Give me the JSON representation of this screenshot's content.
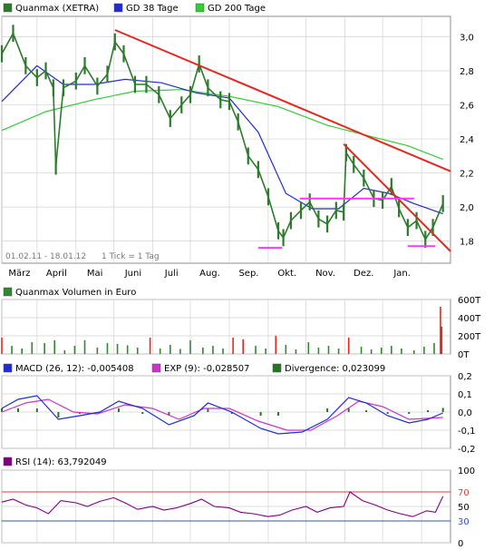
{
  "colors": {
    "background": "#ffffff",
    "frame": "#8c8c8c",
    "grid": "#d2d2d2",
    "price": "#2d7a2d",
    "sma38": "#1f2bd6",
    "sma200": "#33cc33",
    "trend": "#e8261e",
    "support": "#ff33ff",
    "volume": "#2d8a2d",
    "volume_spike": "#e8261e",
    "macd": "#1f2bd6",
    "exp": "#cc33cc",
    "divergence": "#1f7a1f",
    "rsi": "#800080",
    "rsi_upper": "#d6403a",
    "rsi_lower": "#3050d0"
  },
  "chart_data": [
    {
      "type": "line",
      "name": "price",
      "legend": {
        "price": "Quanmax (XETRA)",
        "sma38": "GD 38 Tage",
        "sma200": "GD 200 Tage"
      },
      "date_range_label": "01.02.11 - 18.01.12",
      "tick_note": "1 Tick = 1 Tag",
      "x_labels": [
        "März",
        "April",
        "Mai",
        "Juni",
        "Juli",
        "Aug.",
        "Sep.",
        "Okt.",
        "Nov.",
        "Dez.",
        "Jan."
      ],
      "y_ticks": [
        "3,0",
        "2,8",
        "2,6",
        "2,4",
        "2,2",
        "2,0",
        "1,8"
      ],
      "ylim": [
        1.67,
        3.12
      ],
      "series": [
        {
          "name": "Quanmax (XETRA)",
          "x": [
            "2011-02-01",
            "2011-02-10",
            "2011-02-20",
            "2011-03-01",
            "2011-03-08",
            "2011-03-14",
            "2011-03-16",
            "2011-03-22",
            "2011-04-01",
            "2011-04-08",
            "2011-04-18",
            "2011-04-26",
            "2011-05-02",
            "2011-05-09",
            "2011-05-18",
            "2011-05-27",
            "2011-06-06",
            "2011-06-15",
            "2011-06-24",
            "2011-07-01",
            "2011-07-08",
            "2011-07-15",
            "2011-07-25",
            "2011-08-01",
            "2011-08-08",
            "2011-08-16",
            "2011-08-24",
            "2011-09-01",
            "2011-09-09",
            "2011-09-13",
            "2011-09-19",
            "2011-09-27",
            "2011-10-04",
            "2011-10-11",
            "2011-10-18",
            "2011-10-25",
            "2011-10-31",
            "2011-11-02",
            "2011-11-08",
            "2011-11-16",
            "2011-11-24",
            "2011-12-01",
            "2011-12-08",
            "2011-12-14",
            "2011-12-21",
            "2011-12-28",
            "2012-01-04",
            "2012-01-10",
            "2012-01-18"
          ],
          "y": [
            2.9,
            3.02,
            2.83,
            2.76,
            2.8,
            2.7,
            2.24,
            2.7,
            2.74,
            2.83,
            2.71,
            2.78,
            2.97,
            2.9,
            2.72,
            2.72,
            2.66,
            2.52,
            2.6,
            2.66,
            2.84,
            2.7,
            2.63,
            2.62,
            2.5,
            2.3,
            2.22,
            2.06,
            1.86,
            1.82,
            1.92,
            1.98,
            2.03,
            1.93,
            1.9,
            1.98,
            1.97,
            2.32,
            2.25,
            2.17,
            2.05,
            2.04,
            2.12,
            1.99,
            1.88,
            1.92,
            1.81,
            1.88,
            2.02
          ]
        },
        {
          "name": "GD 38 Tage",
          "x": [
            "2011-02-01",
            "2011-03-01",
            "2011-03-22",
            "2011-04-15",
            "2011-05-10",
            "2011-06-08",
            "2011-07-06",
            "2011-08-01",
            "2011-08-24",
            "2011-09-15",
            "2011-10-06",
            "2011-10-27",
            "2011-11-16",
            "2011-12-06",
            "2011-12-26",
            "2012-01-18"
          ],
          "y": [
            2.62,
            2.83,
            2.72,
            2.72,
            2.75,
            2.73,
            2.67,
            2.64,
            2.44,
            2.08,
            1.99,
            1.99,
            2.11,
            2.08,
            2.02,
            1.96
          ]
        },
        {
          "name": "GD 200 Tage",
          "x": [
            "2011-02-01",
            "2011-03-08",
            "2011-04-15",
            "2011-05-18",
            "2011-06-24",
            "2011-08-01",
            "2011-09-09",
            "2011-10-18",
            "2011-11-24",
            "2011-12-21",
            "2012-01-18"
          ],
          "y": [
            2.45,
            2.56,
            2.63,
            2.68,
            2.69,
            2.65,
            2.59,
            2.48,
            2.41,
            2.36,
            2.28
          ]
        }
      ],
      "annotations": [
        {
          "kind": "trendline",
          "x": [
            "2011-05-02",
            "2012-01-24"
          ],
          "y": [
            3.04,
            2.21
          ]
        },
        {
          "kind": "trendline",
          "x": [
            "2011-10-31",
            "2012-01-24"
          ],
          "y": [
            2.37,
            1.74
          ]
        },
        {
          "kind": "support",
          "x": [
            "2011-09-26",
            "2011-12-26"
          ],
          "y": [
            2.05,
            2.05
          ]
        },
        {
          "kind": "support",
          "x": [
            "2011-08-24",
            "2011-09-12"
          ],
          "y": [
            1.76,
            1.76
          ]
        },
        {
          "kind": "support",
          "x": [
            "2011-12-21",
            "2012-01-12"
          ],
          "y": [
            1.77,
            1.77
          ]
        }
      ]
    },
    {
      "type": "bar",
      "name": "volume",
      "title": "Quanmax Volumen in Euro",
      "y_ticks": [
        "600T",
        "400T",
        "200T",
        "0T"
      ],
      "ylim": [
        0,
        600
      ],
      "unit": "T",
      "x": [
        "2011-02-01",
        "2011-02-09",
        "2011-02-17",
        "2011-02-25",
        "2011-03-07",
        "2011-03-15",
        "2011-03-23",
        "2011-03-31",
        "2011-04-08",
        "2011-04-18",
        "2011-04-26",
        "2011-05-04",
        "2011-05-12",
        "2011-05-20",
        "2011-05-30",
        "2011-06-07",
        "2011-06-15",
        "2011-06-23",
        "2011-07-01",
        "2011-07-11",
        "2011-07-19",
        "2011-07-27",
        "2011-08-04",
        "2011-08-12",
        "2011-08-22",
        "2011-08-30",
        "2011-09-07",
        "2011-09-15",
        "2011-09-23",
        "2011-10-03",
        "2011-10-11",
        "2011-10-19",
        "2011-10-27",
        "2011-11-04",
        "2011-11-14",
        "2011-11-22",
        "2011-11-30",
        "2011-12-08",
        "2011-12-16",
        "2011-12-26",
        "2012-01-03",
        "2012-01-11",
        "2012-01-16",
        "2012-01-17"
      ],
      "values": [
        180,
        90,
        60,
        130,
        120,
        150,
        40,
        90,
        150,
        70,
        120,
        110,
        95,
        70,
        180,
        60,
        100,
        55,
        150,
        70,
        90,
        60,
        180,
        160,
        90,
        60,
        200,
        100,
        50,
        130,
        70,
        90,
        60,
        180,
        80,
        50,
        70,
        90,
        60,
        40,
        80,
        120,
        520,
        300
      ]
    },
    {
      "type": "line",
      "name": "macd",
      "legend": {
        "macd": "MACD (26, 12): -0,005408",
        "exp": "EXP (9): -0,028507",
        "divergence": "Divergence: 0,023099"
      },
      "y_ticks": [
        "0,2",
        "0,1",
        "0,0",
        "-0,1",
        "-0,2"
      ],
      "ylim": [
        -0.2,
        0.2
      ],
      "series": [
        {
          "name": "MACD (26, 12)",
          "x": [
            "2011-02-01",
            "2011-02-14",
            "2011-03-01",
            "2011-03-18",
            "2011-04-04",
            "2011-04-20",
            "2011-05-05",
            "2011-05-24",
            "2011-06-14",
            "2011-07-04",
            "2011-07-15",
            "2011-08-03",
            "2011-08-26",
            "2011-09-09",
            "2011-09-28",
            "2011-10-18",
            "2011-11-04",
            "2011-11-18",
            "2011-12-05",
            "2011-12-22",
            "2012-01-06",
            "2012-01-18"
          ],
          "y": [
            0.02,
            0.07,
            0.09,
            -0.04,
            -0.02,
            0.0,
            0.06,
            0.02,
            -0.07,
            -0.02,
            0.05,
            0.0,
            -0.09,
            -0.12,
            -0.11,
            -0.04,
            0.08,
            0.05,
            -0.02,
            -0.06,
            -0.04,
            -0.005
          ]
        },
        {
          "name": "EXP (9)",
          "x": [
            "2011-02-01",
            "2011-02-20",
            "2011-03-10",
            "2011-03-30",
            "2011-04-18",
            "2011-05-10",
            "2011-06-01",
            "2011-06-22",
            "2011-07-12",
            "2011-08-01",
            "2011-08-24",
            "2011-09-16",
            "2011-10-05",
            "2011-10-26",
            "2011-11-12",
            "2011-12-01",
            "2011-12-22",
            "2012-01-18"
          ],
          "y": [
            0.0,
            0.05,
            0.07,
            0.0,
            -0.01,
            0.04,
            0.02,
            -0.04,
            0.02,
            0.02,
            -0.05,
            -0.1,
            -0.1,
            -0.02,
            0.06,
            0.03,
            -0.04,
            -0.03
          ]
        }
      ],
      "divergence_x": [
        "2011-02-01",
        "2011-02-14",
        "2011-03-01",
        "2011-03-18",
        "2011-04-04",
        "2011-04-20",
        "2011-05-05",
        "2011-05-24",
        "2011-06-14",
        "2011-07-04",
        "2011-07-15",
        "2011-08-03",
        "2011-08-26",
        "2011-09-09",
        "2011-09-28",
        "2011-10-18",
        "2011-11-04",
        "2011-11-18",
        "2011-12-05",
        "2011-12-22",
        "2012-01-06",
        "2012-01-18"
      ],
      "divergence": [
        0.02,
        0.02,
        0.02,
        -0.03,
        -0.01,
        0.0,
        0.02,
        -0.01,
        -0.02,
        0.0,
        0.02,
        -0.01,
        -0.02,
        -0.02,
        0.0,
        0.02,
        0.02,
        0.01,
        -0.01,
        -0.01,
        0.01,
        0.023
      ]
    },
    {
      "type": "line",
      "name": "rsi",
      "legend": {
        "rsi": "RSI (14): 63,792049"
      },
      "y_ticks": [
        "100",
        "70",
        "50",
        "30",
        "0"
      ],
      "ylim": [
        0,
        100
      ],
      "reference_lines": [
        70,
        30
      ],
      "series": [
        {
          "name": "RSI (14)",
          "x": [
            "2011-02-01",
            "2011-02-10",
            "2011-02-20",
            "2011-03-01",
            "2011-03-10",
            "2011-03-20",
            "2011-04-01",
            "2011-04-10",
            "2011-04-20",
            "2011-05-01",
            "2011-05-10",
            "2011-05-20",
            "2011-06-01",
            "2011-06-10",
            "2011-06-20",
            "2011-07-01",
            "2011-07-10",
            "2011-07-20",
            "2011-08-01",
            "2011-08-10",
            "2011-08-20",
            "2011-09-01",
            "2011-09-10",
            "2011-09-20",
            "2011-10-01",
            "2011-10-10",
            "2011-10-20",
            "2011-10-31",
            "2011-11-05",
            "2011-11-15",
            "2011-11-25",
            "2011-12-05",
            "2011-12-15",
            "2011-12-25",
            "2012-01-05",
            "2012-01-12",
            "2012-01-18"
          ],
          "y": [
            56,
            60,
            52,
            48,
            40,
            58,
            55,
            50,
            57,
            62,
            55,
            46,
            50,
            45,
            48,
            54,
            60,
            50,
            48,
            42,
            40,
            36,
            38,
            45,
            50,
            42,
            48,
            50,
            70,
            58,
            52,
            45,
            40,
            36,
            44,
            42,
            64
          ]
        }
      ]
    }
  ]
}
